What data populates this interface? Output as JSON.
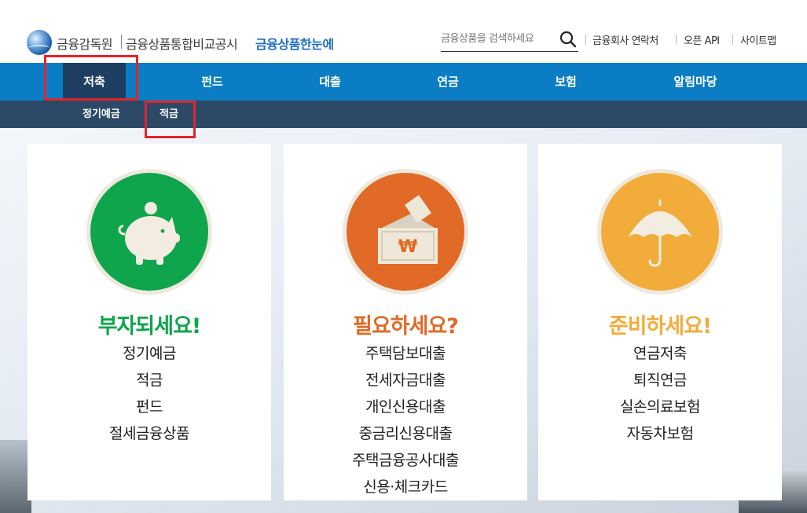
{
  "header": {
    "org_name": "금융감독원",
    "service_name": "금융상품통합비교공시",
    "brand_name": "금융상품한눈에",
    "search_placeholder": "금융상품을 검색하세요",
    "util_links": [
      "금융회사 연락처",
      "오픈 API",
      "사이트맵"
    ]
  },
  "gnb": {
    "items": [
      "저축",
      "펀드",
      "대출",
      "연금",
      "보험",
      "알림마당"
    ],
    "active_index": 0
  },
  "sub_nav": {
    "items": [
      "정기예금",
      "적금"
    ]
  },
  "cards": [
    {
      "headline": "부자되세요!",
      "color": "#0ea54c",
      "icon": "piggy-bank-icon",
      "links": [
        "정기예금",
        "적금",
        "펀드",
        "절세금융상품"
      ]
    },
    {
      "headline": "필요하세요?",
      "color": "#e06a26",
      "icon": "won-envelope-icon",
      "links": [
        "주택담보대출",
        "전세자금대출",
        "개인신용대출",
        "중금리신용대출",
        "주택금융공사대출",
        "신용·체크카드"
      ]
    },
    {
      "headline": "준비하세요!",
      "color": "#f2ac3a",
      "icon": "umbrella-icon",
      "links": [
        "연금저축",
        "퇴직연금",
        "실손의료보험",
        "자동차보험"
      ]
    }
  ],
  "colors": {
    "gnb_bg": "#0b7dc4",
    "gnb_active": "#1e3f62",
    "sub_bg": "#2c4a67",
    "highlight": "#e3242b"
  }
}
